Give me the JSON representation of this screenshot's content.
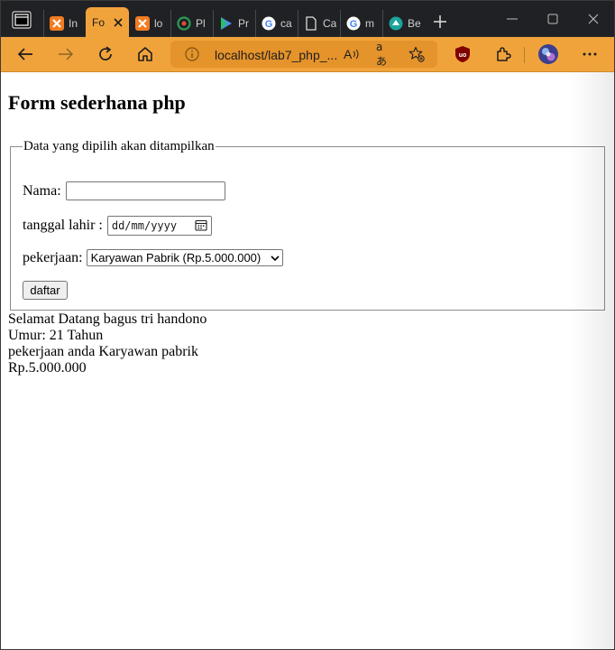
{
  "browser": {
    "tabs": [
      {
        "label": "In",
        "icon": "xampp-icon"
      },
      {
        "label": "Fo",
        "icon": "xampp-icon",
        "active": true
      },
      {
        "label": "lo",
        "icon": "xampp-icon"
      },
      {
        "label": "Pl",
        "icon": "pluto-icon"
      },
      {
        "label": "Pr",
        "icon": "play-icon"
      },
      {
        "label": "ca",
        "icon": "google-icon"
      },
      {
        "label": "Ca",
        "icon": "document-icon"
      },
      {
        "label": "m",
        "icon": "google-icon"
      },
      {
        "label": "Be",
        "icon": "brainly-icon"
      }
    ],
    "address": {
      "url": "localhost/lab7_php_...",
      "read_aloud_label": "A",
      "translate_label": "aあ"
    },
    "colors": {
      "accent": "#f1a33b",
      "tabbar": "#202124"
    }
  },
  "page": {
    "heading": "Form sederhana php",
    "legend": "Data yang dipilih akan ditampilkan",
    "fields": {
      "nama_label": "Nama:",
      "nama_value": "",
      "tanggal_label": "tanggal lahir :",
      "tanggal_placeholder": "dd/mm/yyyy",
      "pekerjaan_label": "pekerjaan:",
      "pekerjaan_selected": "Karyawan Pabrik (Rp.5.000.000)"
    },
    "submit_label": "daftar",
    "output": [
      "Selamat Datang bagus tri handono",
      "Umur: 21 Tahun",
      "pekerjaan anda Karyawan pabrik",
      "Rp.5.000.000"
    ]
  }
}
